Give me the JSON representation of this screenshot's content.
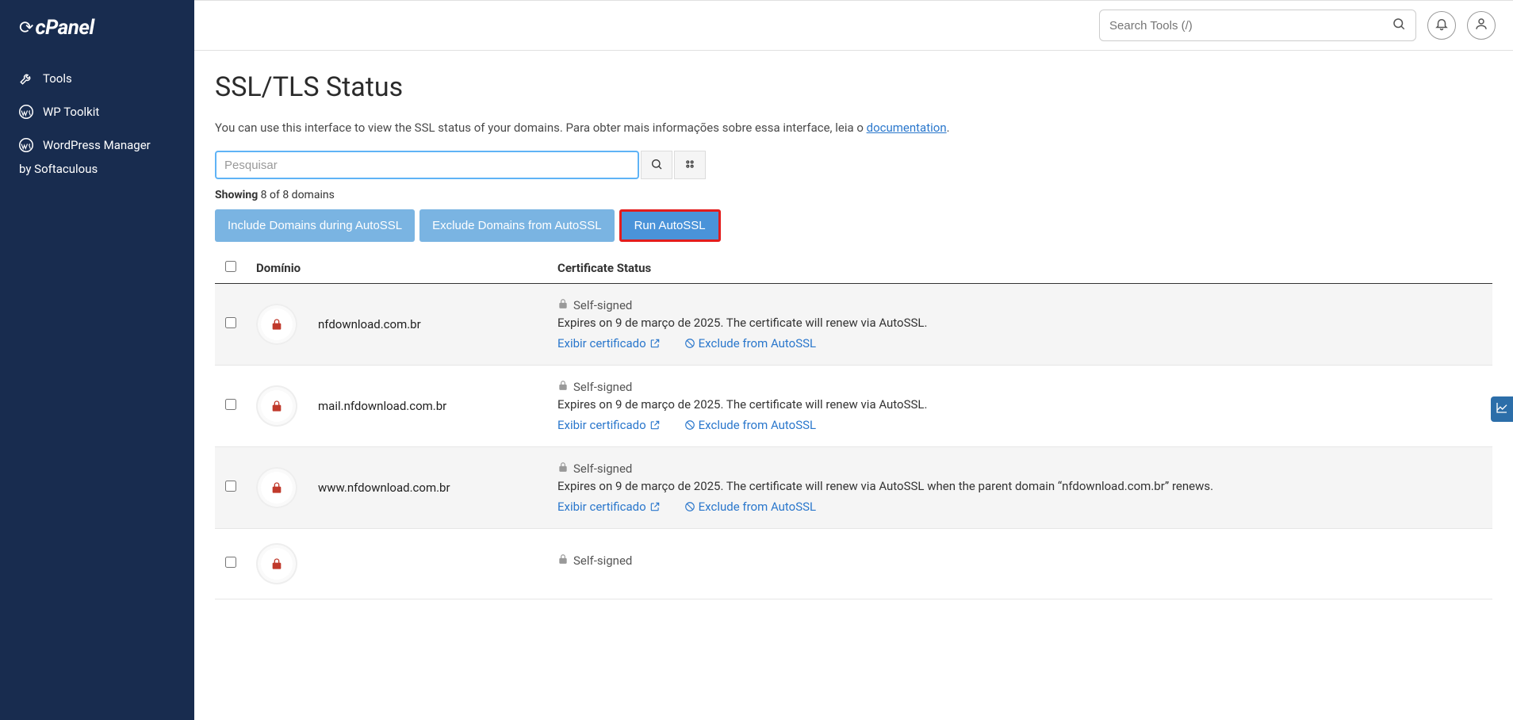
{
  "sidebar": {
    "logo": "cPanel",
    "items": [
      {
        "label": "Tools",
        "icon": "tools"
      },
      {
        "label": "WP Toolkit",
        "icon": "wordpress"
      },
      {
        "label": "WordPress Manager",
        "label2": "by Softaculous",
        "icon": "wordpress"
      }
    ]
  },
  "header": {
    "search_placeholder": "Search Tools (/)"
  },
  "page": {
    "title": "SSL/TLS Status",
    "intro_pre": "You can use this interface to view the SSL status of your domains. Para obter mais informações sobre essa interface, leia o ",
    "intro_link": "documentation",
    "intro_post": ".",
    "filter_placeholder": "Pesquisar",
    "showing_label": "Showing",
    "showing_count": " 8 of 8 domains",
    "buttons": {
      "include": "Include Domains during AutoSSL",
      "exclude": "Exclude Domains from AutoSSL",
      "run": "Run AutoSSL"
    },
    "columns": {
      "domain": "Domínio",
      "status": "Certificate Status"
    },
    "link_view_cert": "Exibir certificado",
    "link_exclude": "Exclude from AutoSSL",
    "rows": [
      {
        "domain": "nfdownload.com.br",
        "status_badge": "Self-signed",
        "expires": "Expires on 9 de março de 2025. The certificate will renew via AutoSSL."
      },
      {
        "domain": "mail.nfdownload.com.br",
        "status_badge": "Self-signed",
        "expires": "Expires on 9 de março de 2025. The certificate will renew via AutoSSL."
      },
      {
        "domain": "www.nfdownload.com.br",
        "status_badge": "Self-signed",
        "expires": "Expires on 9 de março de 2025. The certificate will renew via AutoSSL when the parent domain “nfdownload.com.br” renews."
      },
      {
        "domain": "",
        "status_badge": "Self-signed",
        "expires": ""
      }
    ]
  }
}
